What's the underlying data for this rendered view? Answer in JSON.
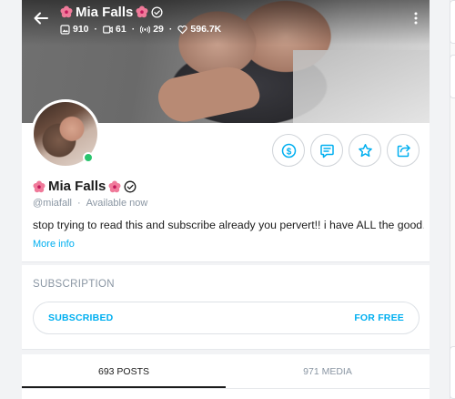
{
  "header": {
    "name": "Mia Falls",
    "stats": {
      "photos": "910",
      "videos": "61",
      "streams": "29",
      "likes": "596.7K"
    }
  },
  "profile": {
    "name": "Mia Falls",
    "handle": "@miafall",
    "separator": "·",
    "status": "Available now",
    "bio": "stop trying to read this and subscribe already you pervert!! i have ALL the good…",
    "more_info": "More info"
  },
  "actions": [
    "tip-button",
    "message-button",
    "favorite-button",
    "share-button"
  ],
  "subscription": {
    "title": "SUBSCRIPTION",
    "status": "SUBSCRIBED",
    "price": "FOR FREE"
  },
  "tabs": [
    {
      "label": "693 POSTS",
      "active": true
    },
    {
      "label": "971 MEDIA",
      "active": false
    }
  ],
  "colors": {
    "accent": "#00aff0",
    "online": "#29c46d",
    "muted": "#8a96a3"
  },
  "icons": [
    "back-arrow-icon",
    "flower-icon",
    "verified-icon",
    "photo-icon",
    "video-icon",
    "stream-icon",
    "heart-icon",
    "kebab-menu-icon",
    "dollar-icon",
    "message-icon",
    "star-icon",
    "share-icon"
  ]
}
